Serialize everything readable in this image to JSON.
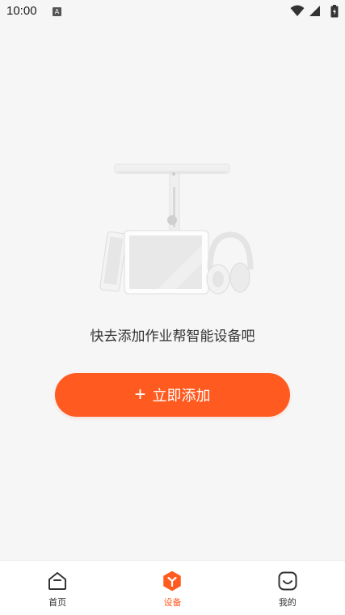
{
  "status_bar": {
    "time": "10:00"
  },
  "empty_state": {
    "message": "快去添加作业帮智能设备吧",
    "add_button_label": "立即添加",
    "add_button_icon": "plus-icon"
  },
  "tabs": [
    {
      "label": "首页",
      "icon": "home-icon",
      "active": false
    },
    {
      "label": "设备",
      "icon": "device-icon",
      "active": true
    },
    {
      "label": "我的",
      "icon": "profile-smile-icon",
      "active": false
    }
  ],
  "colors": {
    "accent": "#ff5a1f",
    "background": "#f6f6f6",
    "tab_inactive": "#333333"
  }
}
